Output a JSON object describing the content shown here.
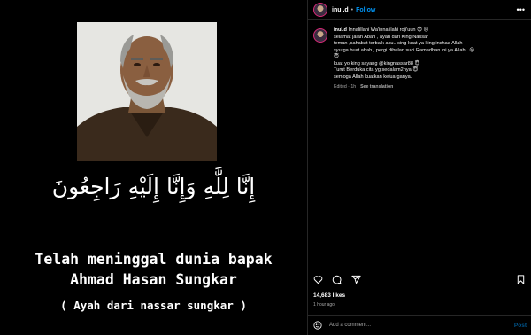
{
  "media": {
    "arabic_text": "إِنَّا لِلَّٰهِ وَإِنَّا إِلَيْهِ رَاجِعُونَ",
    "line1": "Telah meninggal dunia bapak",
    "line2": "Ahmad Hasan Sungkar",
    "line3": "( Ayah dari nassar sungkar )"
  },
  "header": {
    "username": "inul.d",
    "separator": "•",
    "follow_label": "Follow",
    "more_icon": "more-horizontal-icon",
    "more_glyph": "•••"
  },
  "caption": {
    "username": "inul.d",
    "lines": [
      "Innalillahi Wa'inna ilahi roji'uun 😇 😢",
      "selamat jalan Abah , ayah dari King Nassar",
      "teman ,sahabat terbaik aku.. sing kuat ya king inshaa Allah",
      "syurga buat abah , pergi dibulan suci Ramadhan ini ya Allah.. 😢",
      "😇",
      "kuat yo king sayang @kingnassar88 😇",
      "Turut Berduka cita yg sedalam2nya 😇",
      "semoga Allah kuatkan keluarganya."
    ],
    "edited": "Edited · 1h",
    "see_translation": "See translation"
  },
  "actions": {
    "like_icon": "heart-icon",
    "comment_icon": "comment-icon",
    "share_icon": "share-icon",
    "save_icon": "bookmark-icon"
  },
  "likes": "14,683 likes",
  "time": "1 hour ago",
  "add_comment": {
    "emoji_icon": "emoji-icon",
    "placeholder": "Add a comment...",
    "post_label": "Post"
  },
  "colors": {
    "accent": "#0095f6",
    "background": "#000000",
    "border": "#262626",
    "muted": "#a8a8a8"
  }
}
